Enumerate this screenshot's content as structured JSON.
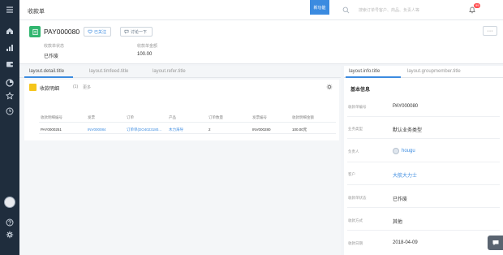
{
  "topbar": {
    "title": "收款单",
    "new_button": "新功能",
    "search_placeholder": "搜索订单号客户、商品、负责人等",
    "notif_count": "99"
  },
  "header": {
    "record_id": "PAY000080",
    "follow_label": "已关注",
    "chat_label": "讨论一下",
    "fields": [
      {
        "label": "收款单状态",
        "value": "已作废"
      },
      {
        "label": "收款单金额",
        "value": "100.00"
      }
    ]
  },
  "tabs": [
    "layout.detail.title",
    "layout.timfeed.title",
    "layout.refer.title"
  ],
  "detail_card": {
    "title": "收款明细",
    "count": "(1)",
    "more": "更多",
    "columns": [
      "收款明细编号",
      "发票",
      "订单",
      "产品",
      "订单数量",
      "发票编号",
      "收款明细金额"
    ],
    "rows": [
      [
        "PAY0000251",
        "INV000084",
        "订单单(DO4023180...",
        "木力海导",
        "2",
        "INV000280",
        "100.00元"
      ]
    ]
  },
  "right_panel": {
    "tabs": [
      "layout.info.title",
      "layout.groupmember.title"
    ],
    "section_title": "基本信息",
    "items": [
      {
        "label": "收款单编号",
        "value": "PAY000080"
      },
      {
        "label": "业务类型",
        "value": "默认业务类型"
      },
      {
        "label": "负责人",
        "value": "hougu"
      },
      {
        "label": "客户",
        "value": "大航大力士"
      },
      {
        "label": "收款单状态",
        "value": "已作废"
      },
      {
        "label": "收款方式",
        "value": "其他"
      },
      {
        "label": "收款日期",
        "value": "2018-04-09"
      }
    ]
  },
  "colors": {
    "accent": "#3b8be0",
    "nav": "#1f2d3d",
    "record_icon": "#31b66f",
    "card_icon": "#f5c51b"
  }
}
